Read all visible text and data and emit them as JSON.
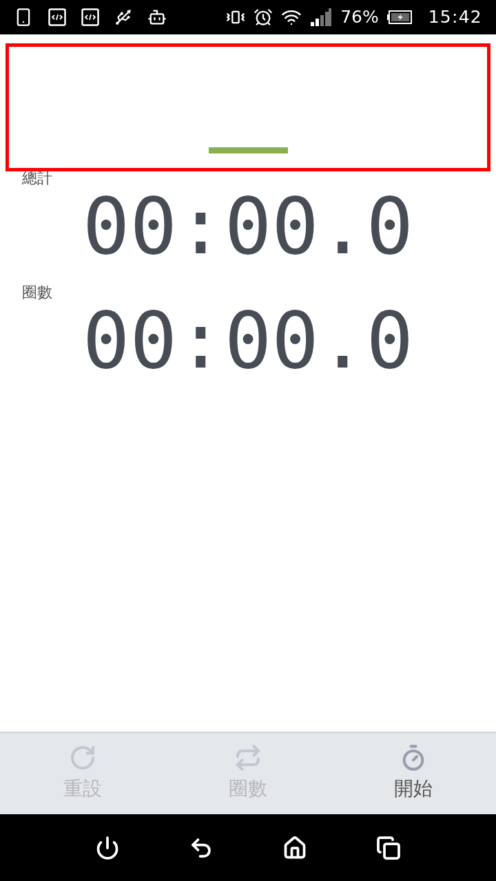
{
  "status_bar": {
    "battery": "76%",
    "time": "15:42"
  },
  "timers": [
    {
      "label": "總計",
      "reading": "00:00.0"
    },
    {
      "label": "圈數",
      "reading": "00:00.0"
    }
  ],
  "actions": [
    {
      "kind": "reset",
      "label": "重設",
      "disabled": true
    },
    {
      "kind": "lap",
      "label": "圈數",
      "disabled": true
    },
    {
      "kind": "start",
      "label": "開始",
      "disabled": false
    }
  ]
}
